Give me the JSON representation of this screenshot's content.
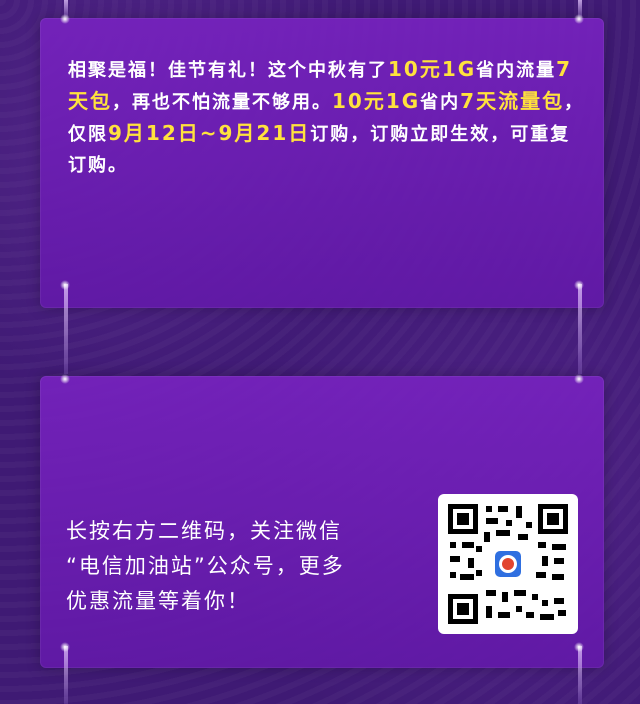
{
  "promo": {
    "p1": "相聚是福！佳节有礼！这个中秋有了",
    "h1": "10元1G",
    "p2": "省内流量",
    "h2": "7天包",
    "p3": "，再也不怕流量不够用。",
    "h3": "10元1G",
    "p4": "省内",
    "h4": "7天流量包",
    "p5": "，仅限",
    "h5": "9月12日~9月21日",
    "p6": "订购，订购立即生效，可重复订购。"
  },
  "follow": {
    "line1": "长按右方二维码，关注微信",
    "line2": "“电信加油站”公众号，更多",
    "line3": "优惠流量等着你！"
  },
  "colors": {
    "background": "#3f1a74",
    "panel": "#7622be",
    "highlight": "#ffe23d",
    "text": "#ffffff"
  }
}
